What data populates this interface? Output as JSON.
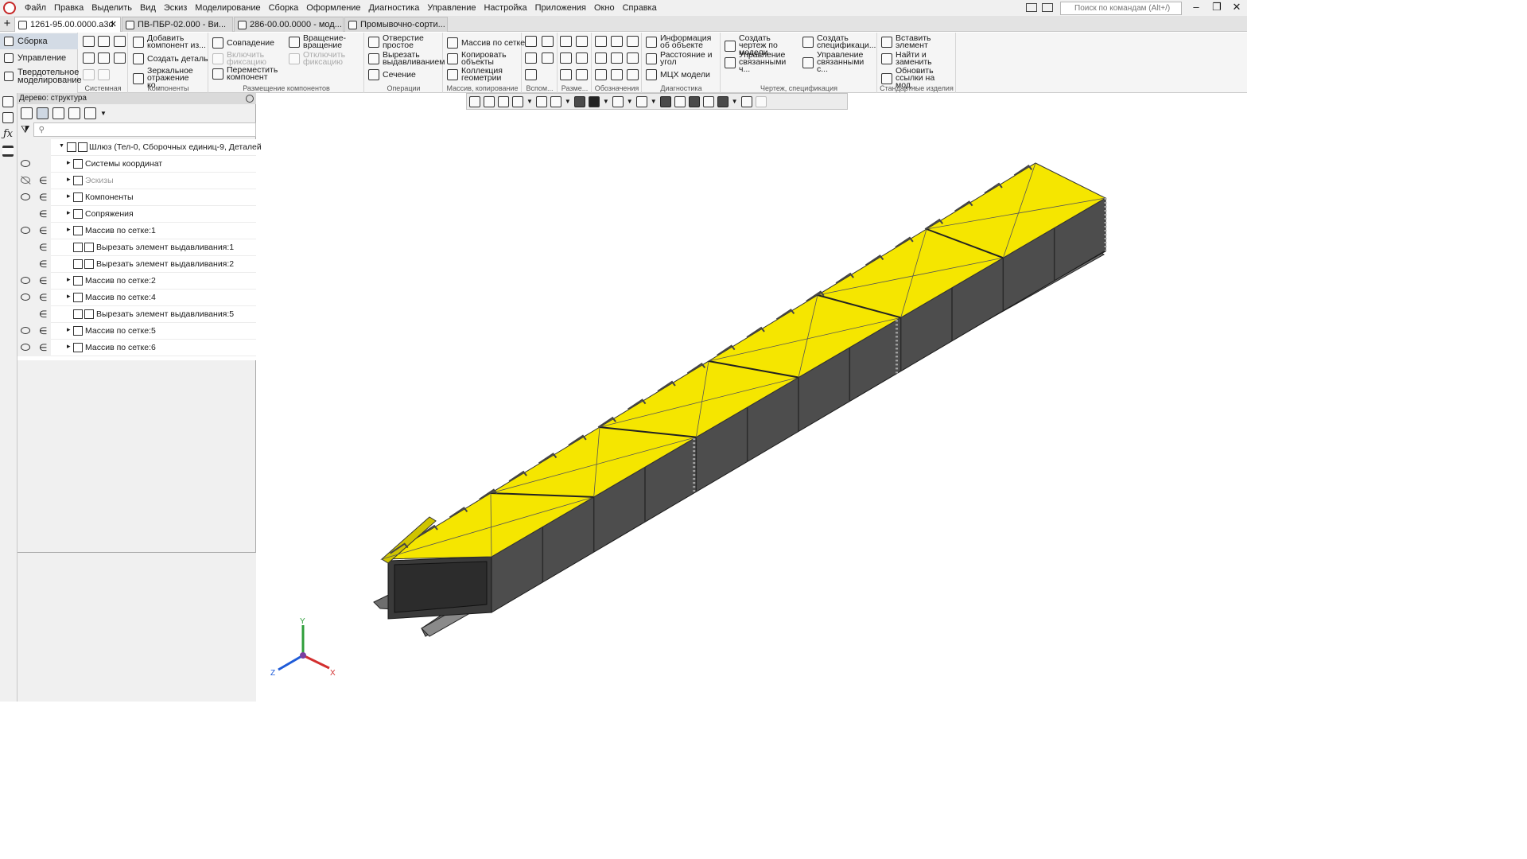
{
  "menu": [
    "Файл",
    "Правка",
    "Выделить",
    "Вид",
    "Эскиз",
    "Моделирование",
    "Сборка",
    "Оформление",
    "Диагностика",
    "Управление",
    "Настройка",
    "Приложения",
    "Окно",
    "Справка"
  ],
  "command_search_placeholder": "Поиск по командам (Alt+/)",
  "tabs": [
    {
      "label": "1261-95.00.0000.a3d",
      "active": true
    },
    {
      "label": "ПВ-ПБР-02.000 - Ви...",
      "active": false
    },
    {
      "label": "286-00.00.0000 - мод...",
      "active": false
    },
    {
      "label": "Промывочно-сорти...",
      "active": false
    }
  ],
  "modes": [
    "Сборка",
    "Управление",
    "Твердотельное моделирование"
  ],
  "ribbon": {
    "groups": [
      "Системная",
      "Компоненты",
      "Размещение компонентов",
      "Операции",
      "Массив, копирование",
      "Вспом...",
      "Разме...",
      "Обозначения",
      "Диагностика",
      "Чертеж, спецификация",
      "Стандартные изделия"
    ],
    "components": [
      "Добавить компонент из...",
      "Создать деталь",
      "Зеркальное отражение ко..."
    ],
    "placement_1": [
      "Совпадение",
      "Включить фиксацию",
      "Переместить компонент"
    ],
    "placement_2": [
      "Вращение-вращение",
      "Отключить фиксацию"
    ],
    "operations": [
      "Отверстие простое",
      "Вырезать выдавливанием",
      "Сечение"
    ],
    "array": [
      "Массив по сетке",
      "Копировать объекты",
      "Коллекция геометрии"
    ],
    "diagnostics": [
      "Информация об объекте",
      "Расстояние и угол",
      "МЦХ модели"
    ],
    "drawing_1": [
      "Создать чертеж по модели",
      "Управление связанными ч..."
    ],
    "drawing_2": [
      "Создать спецификаци...",
      "Управление связанными с..."
    ],
    "standard": [
      "Вставить элемент",
      "Найти и заменить",
      "Обновить ссылки на мод..."
    ]
  },
  "tree": {
    "title": "Дерево: структура",
    "root": "Шлюз (Тел-0, Сборочных единиц-9, Деталей",
    "items": [
      {
        "label": "Системы координат",
        "visible": true,
        "included": false,
        "expand": true,
        "indent": 1
      },
      {
        "label": "Эскизы",
        "visible": false,
        "included": true,
        "expand": true,
        "indent": 1,
        "dim": true
      },
      {
        "label": "Компоненты",
        "visible": true,
        "included": true,
        "expand": true,
        "indent": 1
      },
      {
        "label": "Сопряжения",
        "visible": false,
        "included": true,
        "expand": true,
        "indent": 1
      },
      {
        "label": "Массив по сетке:1",
        "visible": true,
        "included": true,
        "expand": true,
        "indent": 1
      },
      {
        "label": "Вырезать элемент выдавливания:1",
        "visible": false,
        "included": true,
        "expand": false,
        "indent": 2
      },
      {
        "label": "Вырезать элемент выдавливания:2",
        "visible": false,
        "included": true,
        "expand": false,
        "indent": 2
      },
      {
        "label": "Массив по сетке:2",
        "visible": true,
        "included": true,
        "expand": true,
        "indent": 1
      },
      {
        "label": "Массив по сетке:4",
        "visible": true,
        "included": true,
        "expand": true,
        "indent": 1
      },
      {
        "label": "Вырезать элемент выдавливания:5",
        "visible": false,
        "included": true,
        "expand": false,
        "indent": 2
      },
      {
        "label": "Массив по сетке:5",
        "visible": true,
        "included": true,
        "expand": true,
        "indent": 1
      },
      {
        "label": "Массив по сетке:6",
        "visible": true,
        "included": true,
        "expand": true,
        "indent": 1
      }
    ]
  },
  "triad": {
    "x": "X",
    "y": "Y",
    "z": "Z"
  },
  "colors": {
    "lid": "#f5e600",
    "body": "#4d4d4d",
    "frame": "#6e6e6e",
    "accent": "#c62828"
  }
}
